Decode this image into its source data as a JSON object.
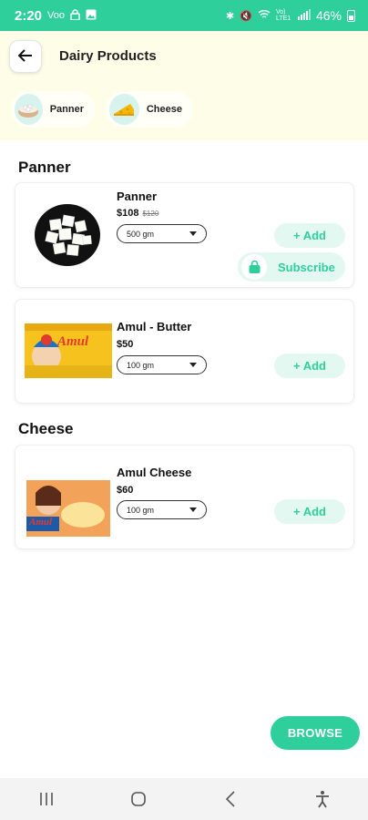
{
  "status_bar": {
    "time": "2:20",
    "carrier_icon": "Voo",
    "network_text": "Vo) LTE1",
    "battery": "46%",
    "bg_color": "#2fcf9b"
  },
  "header": {
    "title": "Dairy Products",
    "back_icon": "arrow-left-icon"
  },
  "category_chips": [
    {
      "label": "Panner",
      "icon": "paneer-bowl-icon"
    },
    {
      "label": "Cheese",
      "icon": "cheese-wedge-icon"
    }
  ],
  "sections": [
    {
      "title": "Panner",
      "products": [
        {
          "name": "Panner",
          "price": "$108",
          "mrp": "$120",
          "qty": "500 gm",
          "add_label": "+ Add",
          "subscribe_label": "Subscribe",
          "image": "paneer-cubes-image"
        },
        {
          "name": "Amul - Butter",
          "price": "$50",
          "qty": "100 gm",
          "add_label": "+ Add",
          "image": "amul-butter-pack-image",
          "brand_text": "Amul"
        }
      ]
    },
    {
      "title": "Cheese",
      "products": [
        {
          "name": "Amul Cheese",
          "price": "$60",
          "qty": "100 gm",
          "add_label": "+ Add",
          "image": "amul-cheese-pack-image",
          "brand_text": "Amul"
        }
      ]
    }
  ],
  "browse_label": "BROWSE",
  "nav": {
    "recent": "recent-apps-icon",
    "home": "home-icon",
    "back": "back-icon",
    "accessibility": "accessibility-icon"
  },
  "colors": {
    "accent": "#2fcf9b",
    "accent_soft": "#e3f8f1",
    "header_bg": "#fefee8"
  }
}
